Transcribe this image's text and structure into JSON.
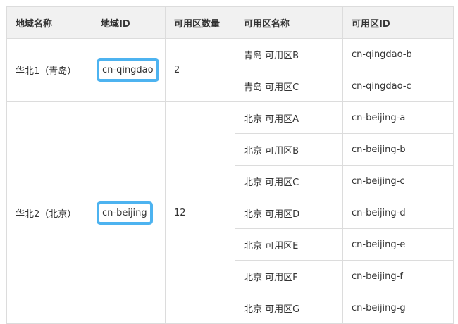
{
  "table": {
    "headers": [
      "地域名称",
      "地域ID",
      "可用区数量",
      "可用区名称",
      "可用区ID"
    ],
    "regions": [
      {
        "name": "华北1（青岛）",
        "id": "cn-qingdao",
        "zone_count": "2",
        "zones": [
          {
            "name": "青岛 可用区B",
            "id": "cn-qingdao-b"
          },
          {
            "name": "青岛 可用区C",
            "id": "cn-qingdao-c"
          }
        ]
      },
      {
        "name": "华北2（北京）",
        "id": "cn-beijing",
        "zone_count": "12",
        "zones": [
          {
            "name": "北京 可用区A",
            "id": "cn-beijing-a"
          },
          {
            "name": "北京 可用区B",
            "id": "cn-beijing-b"
          },
          {
            "name": "北京 可用区C",
            "id": "cn-beijing-c"
          },
          {
            "name": "北京 可用区D",
            "id": "cn-beijing-d"
          },
          {
            "name": "北京 可用区E",
            "id": "cn-beijing-e"
          },
          {
            "name": "北京 可用区F",
            "id": "cn-beijing-f"
          },
          {
            "name": "北京 可用区G",
            "id": "cn-beijing-g"
          }
        ]
      }
    ]
  },
  "colors": {
    "highlight": "#4db3f0",
    "header_bg": "#f1f1f1",
    "border": "#dcdcdc"
  }
}
